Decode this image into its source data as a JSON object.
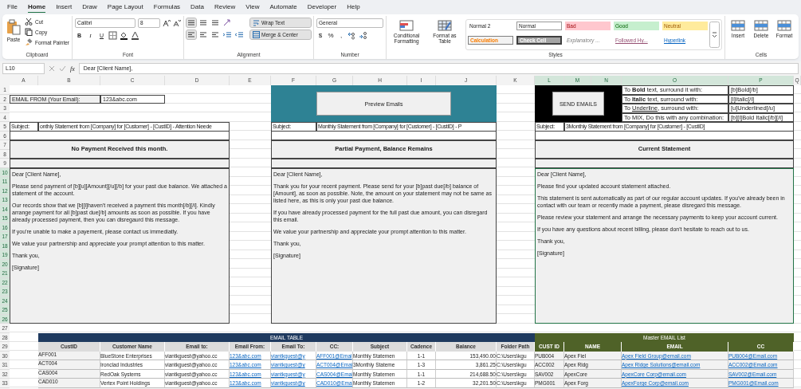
{
  "menu_tabs": [
    {
      "label": "File",
      "selected": false
    },
    {
      "label": "Home",
      "selected": true
    },
    {
      "label": "Insert",
      "selected": false
    },
    {
      "label": "Draw",
      "selected": false
    },
    {
      "label": "Page Layout",
      "selected": false
    },
    {
      "label": "Formulas",
      "selected": false
    },
    {
      "label": "Data",
      "selected": false
    },
    {
      "label": "Review",
      "selected": false
    },
    {
      "label": "View",
      "selected": false
    },
    {
      "label": "Automate",
      "selected": false
    },
    {
      "label": "Developer",
      "selected": false
    },
    {
      "label": "Help",
      "selected": false
    }
  ],
  "ribbon": {
    "clipboard": {
      "label": "Clipboard",
      "paste": "Paste",
      "cut": "Cut",
      "copy": "Copy",
      "format_painter": "Format Painter"
    },
    "font": {
      "label": "Font",
      "name": "Calibri",
      "size": "8",
      "styles": [
        "B",
        "I",
        "U"
      ]
    },
    "alignment": {
      "label": "Alignment",
      "wrap_text": {
        "label": "Wrap Text",
        "on": true
      },
      "merge_center": {
        "label": "Merge & Center",
        "on": true
      }
    },
    "number": {
      "label": "Number",
      "format": "General",
      "symbols": [
        "$",
        "%",
        ","
      ]
    },
    "styles": {
      "label": "Styles",
      "conditional_formatting": "Conditional Formatting",
      "format_as_table": "Format as Table",
      "gallery": [
        {
          "label": "Normal 2",
          "kind": "plain"
        },
        {
          "label": "Normal",
          "kind": "normal"
        },
        {
          "label": "Bad",
          "kind": "bad"
        },
        {
          "label": "Good",
          "kind": "good"
        },
        {
          "label": "Neutral",
          "kind": "neutral"
        },
        {
          "label": "Calculation",
          "kind": "calculation"
        },
        {
          "label": "Check Cell",
          "kind": "check"
        },
        {
          "label": "Explanatory ...",
          "kind": "explanatory"
        },
        {
          "label": "Followed Hy...",
          "kind": "followed"
        },
        {
          "label": "Hyperlink",
          "kind": "hyperlink"
        }
      ]
    },
    "cells": {
      "label": "Cells",
      "buttons": [
        "Insert",
        "Delete",
        "Format"
      ]
    }
  },
  "formula_bar": {
    "name_box": "L10",
    "fx": "fx",
    "formula": "Dear [Client Name],"
  },
  "sheet": {
    "column_headers": [
      {
        "label": "A",
        "selected": false
      },
      {
        "label": "B",
        "selected": false
      },
      {
        "label": "C",
        "selected": false
      },
      {
        "label": "D",
        "selected": false
      },
      {
        "label": "E",
        "selected": false
      },
      {
        "label": "F",
        "selected": false
      },
      {
        "label": "G",
        "selected": false
      },
      {
        "label": "H",
        "selected": false
      },
      {
        "label": "I",
        "selected": false
      },
      {
        "label": "J",
        "selected": false
      },
      {
        "label": "K",
        "selected": false
      },
      {
        "label": "L",
        "selected": true
      },
      {
        "label": "M",
        "selected": true
      },
      {
        "label": "N",
        "selected": true
      },
      {
        "label": "O",
        "selected": true
      },
      {
        "label": "P",
        "selected": true
      },
      {
        "label": "Q",
        "selected": false
      }
    ],
    "row_numbers": [
      {
        "label": "1",
        "selected": false
      },
      {
        "label": "2",
        "selected": false
      },
      {
        "label": "3",
        "selected": false
      },
      {
        "label": "4",
        "selected": false
      },
      {
        "label": "5",
        "selected": false
      },
      {
        "label": "6",
        "selected": false
      },
      {
        "label": "7",
        "selected": false
      },
      {
        "label": "8",
        "selected": false
      },
      {
        "label": "9",
        "selected": false
      },
      {
        "label": "10",
        "selected": true
      },
      {
        "label": "11",
        "selected": true
      },
      {
        "label": "12",
        "selected": true
      },
      {
        "label": "13",
        "selected": true
      },
      {
        "label": "14",
        "selected": true
      },
      {
        "label": "15",
        "selected": true
      },
      {
        "label": "16",
        "selected": true
      },
      {
        "label": "17",
        "selected": true
      },
      {
        "label": "18",
        "selected": true
      },
      {
        "label": "19",
        "selected": true
      },
      {
        "label": "20",
        "selected": true
      },
      {
        "label": "21",
        "selected": true
      },
      {
        "label": "22",
        "selected": true
      },
      {
        "label": "23",
        "selected": true
      },
      {
        "label": "24",
        "selected": true
      },
      {
        "label": "25",
        "selected": true
      },
      {
        "label": "26",
        "selected": true
      },
      {
        "label": "27",
        "selected": false
      },
      {
        "label": "28",
        "selected": false
      },
      {
        "label": "29",
        "selected": false
      },
      {
        "label": "30",
        "selected": false
      },
      {
        "label": "31",
        "selected": false
      },
      {
        "label": "32",
        "selected": false
      },
      {
        "label": "33",
        "selected": false
      }
    ],
    "email_from": {
      "label": "EMAIL FROM (Your Email):",
      "value": "123&abc.com"
    },
    "preview_button": "Preview Emails",
    "send_button": "SEND EMAILS",
    "format_help": [
      {
        "parts": [
          {
            "text": "To "
          },
          {
            "text": "Bold",
            "kind": "bold"
          },
          {
            "text": " text, surround it with:"
          }
        ],
        "code": "[b]Bold[/b]"
      },
      {
        "parts": [
          {
            "text": "To "
          },
          {
            "text": "Italic",
            "kind": "bold"
          },
          {
            "text": " text, surround with:"
          }
        ],
        "code": "[i]Italic[/i]"
      },
      {
        "parts": [
          {
            "text": "To "
          },
          {
            "text": "Underline",
            "kind": "underline"
          },
          {
            "text": ", surround with:"
          }
        ],
        "code": "[u]Underlined[/u]"
      },
      {
        "parts": [
          {
            "text": "To MIX, Do this with any combination:"
          }
        ],
        "code": "[b][i]Bold Italic[/b][/i]"
      }
    ],
    "templates": [
      {
        "subject_label": "Subject:",
        "subject": "onthly Statement from [Company] for [Customer] - [CustID] - Attention Neede",
        "title": "No Payment Received this month.",
        "selected": false,
        "paragraphs": [
          "Dear [Client Name],",
          "Please send payment of [b][u][Amount][/u][/b] for your past due balance. We attached a statement of the account.",
          "Our records show that we [b][i]haven't received a payment this month[/b][/i]. Kindly arrange payment for all [b]past due[/b] amounts as soon as possible. If you have already processed payment, then you can disregaurd this message.",
          "If you're unable to make a payement, please contact us immediatly.",
          "We value your partnership and appreciate your prompt attention to this matter.",
          "Thank you,",
          "[Signature]"
        ]
      },
      {
        "subject_label": "Subject:",
        "subject": "Monthly Statement from [Company] for [Customer] - [CustID] - P",
        "title": "Partial Payment, Balance Remains",
        "selected": false,
        "paragraphs": [
          "Dear [Client Name],",
          "Thank you for your recent payment. Please send for your [b]past due[/b] balance of [Amount], as soon as possible. Note, the amount on your statement may not be same as listed here, as this is only your past due balance.",
          "If you have already processed payment for the full past due amount, you can disregard this email.",
          "We value your partnership and appreciate your prompt attention to this matter.",
          "Thank you,",
          "[Signature]"
        ]
      },
      {
        "subject_label": "Subject:",
        "subject": "3Monthly Statement from [Company] for [Customer] - [CustID]",
        "title": "Current Statement",
        "selected": true,
        "paragraphs": [
          "Dear [Client Name],",
          "Please find your updated account statement attached.",
          "This statement is sent automatically as part of our regular account updates. If you've already been in contact with our team or recently made a payment, please disregard this message.",
          "Please review your statement and arrange the necessary payments to keep your account current.",
          "If you have any questions about recent billing, please don't hesitate to reach out to us.",
          "Thank you,",
          "[Signature]"
        ]
      }
    ],
    "email_table": {
      "title": "EMAIL TABLE",
      "columns": [
        {
          "label": "CustID",
          "kind": "text"
        },
        {
          "label": "Customer Name",
          "kind": "text"
        },
        {
          "label": "Email to:",
          "kind": "text"
        },
        {
          "label": "Email From:",
          "kind": "link"
        },
        {
          "label": "Email To:",
          "kind": "link"
        },
        {
          "label": "CC:",
          "kind": "link"
        },
        {
          "label": "Subject",
          "kind": "text"
        },
        {
          "label": "Cadence",
          "kind": "center"
        },
        {
          "label": "Balance",
          "kind": "number"
        },
        {
          "label": "Folder Path",
          "kind": "text"
        }
      ],
      "rows": [
        [
          "AFF001",
          "BlueStone Enterprises",
          "viantkguest@yahoo.cc",
          "123&abc.com",
          "viantkguest@y",
          "AFF001@Emai",
          "Monthly Statemen",
          "1-1",
          "153,490.00",
          "C:\\Users\\kgu"
        ],
        [
          "ACT004",
          "Ironclad Industries",
          "viantkguest@yahoo.cc",
          "123&abc.com",
          "viantkguest@y",
          "ACT004@Emai",
          "3Monthly Stateme",
          "1-3",
          "3,861.25",
          "C:\\Users\\kgu"
        ],
        [
          "CAS004",
          "RedOak Systems",
          "viantkguest@yahoo.cc",
          "123&abc.com",
          "viantkguest@y",
          "CAS004@Emai",
          "Monthly Statemen",
          "1-1",
          "214,688.50",
          "C:\\Users\\kgu"
        ],
        [
          "CAD010",
          "Vertex Point Holdings",
          "viantkguest@yahoo.cc",
          "123&abc.com",
          "viantkguest@y",
          "CAD010@Emai",
          "Monthly Statemen",
          "1-2",
          "32,201.50",
          "C:\\Users\\kgu"
        ]
      ]
    },
    "master_list": {
      "title": "Master EMAIL List",
      "columns": [
        {
          "label": "CUST ID",
          "kind": "text"
        },
        {
          "label": "NAME",
          "kind": "text"
        },
        {
          "label": "EMAIL",
          "kind": "link"
        },
        {
          "label": "CC",
          "kind": "link"
        }
      ],
      "rows": [
        [
          "PUB004",
          "Apex Fiel",
          "Apex Field Group@email.com",
          "PUB004@Email.com"
        ],
        [
          "ACC002",
          "Apex Ridg",
          "Apex Ridge Solutions@email.com",
          "ACC002@Email.com"
        ],
        [
          "SAV002",
          "ApexCore",
          "ApexCore Corp@email.com",
          "SAV002@Email.com"
        ],
        [
          "PMG001",
          "Apex Forg",
          "ApexForge Corp@email.com",
          "PMG001@Email.com"
        ]
      ]
    }
  }
}
